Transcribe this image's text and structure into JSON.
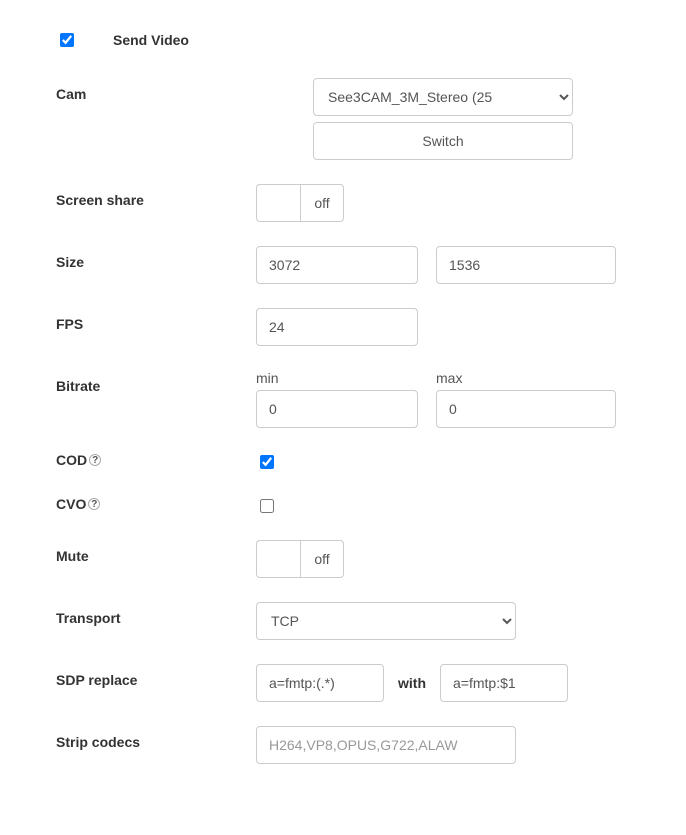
{
  "header": {
    "title": "Send Video",
    "checked": true
  },
  "cam": {
    "label": "Cam",
    "selected": "See3CAM_3M_Stereo (25",
    "switch_label": "Switch"
  },
  "screen_share": {
    "label": "Screen share",
    "toggle_off": "off"
  },
  "size": {
    "label": "Size",
    "width": "3072",
    "height": "1536"
  },
  "fps": {
    "label": "FPS",
    "value": "24"
  },
  "bitrate": {
    "label": "Bitrate",
    "min_label": "min",
    "max_label": "max",
    "min": "0",
    "max": "0"
  },
  "cod": {
    "label": "COD",
    "checked": true
  },
  "cvo": {
    "label": "CVO",
    "checked": false
  },
  "mute": {
    "label": "Mute",
    "toggle_off": "off"
  },
  "transport": {
    "label": "Transport",
    "selected": "TCP"
  },
  "sdp": {
    "label": "SDP replace",
    "pattern": "a=fmtp:(.*)",
    "with_label": "with",
    "replacement": "a=fmtp:$1"
  },
  "strip": {
    "label": "Strip codecs",
    "placeholder": "H264,VP8,OPUS,G722,ALAW"
  },
  "help_glyph": "?"
}
